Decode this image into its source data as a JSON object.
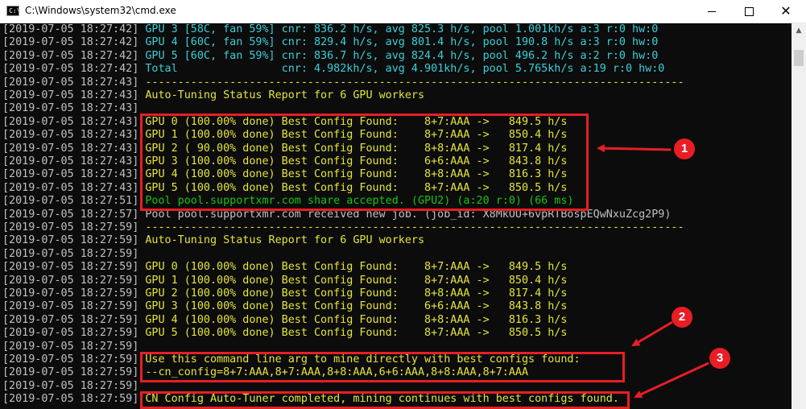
{
  "window": {
    "title": "C:\\Windows\\system32\\cmd.exe",
    "icon_label": "C:\\",
    "minimize_icon": "minimize-icon",
    "maximize_icon": "maximize-icon",
    "close_icon": "close-icon"
  },
  "colors": {
    "console_bg": "#0c0c0c",
    "timestamp": "#c0c0c0",
    "cyan": "#3ad0d9",
    "yellow": "#e5e53b",
    "green": "#16c60c",
    "annotation_red": "#e81e24"
  },
  "lines": [
    {
      "ts": "[2019-07-05 18:27:42]",
      "msg": " GPU 3 [58C, fan 59%] cnr: 836.2 h/s, avg 825.3 h/s, pool 1.001kh/s a:3 r:0 hw:0"
    },
    {
      "ts": "[2019-07-05 18:27:42]",
      "msg": " GPU 4 [60C, fan 59%] cnr: 829.4 h/s, avg 801.4 h/s, pool 190.8 h/s a:3 r:0 hw:0"
    },
    {
      "ts": "[2019-07-05 18:27:42]",
      "msg": " GPU 5 [60C, fan 59%] cnr: 836.7 h/s, avg 824.4 h/s, pool 496.2 h/s a:2 r:0 hw:0"
    },
    {
      "ts": "[2019-07-05 18:27:42]",
      "msg": " Total                cnr: 4.982kh/s, avg 4.901kh/s, pool 5.765kh/s a:19 r:0 hw:0"
    },
    {
      "ts": "[2019-07-05 18:27:43]",
      "msg": " -----------------------------------------------------------------------------------"
    },
    {
      "ts": "[2019-07-05 18:27:43]",
      "msg": " Auto-Tuning Status Report for 6 GPU workers"
    },
    {
      "ts": "[2019-07-05 18:27:43]",
      "msg": ""
    },
    {
      "ts": "[2019-07-05 18:27:43]",
      "msg": " GPU 0 (100.00% done) Best Config Found:    8+7:AAA ->   849.5 h/s"
    },
    {
      "ts": "[2019-07-05 18:27:43]",
      "msg": " GPU 1 (100.00% done) Best Config Found:    8+7:AAA ->   850.4 h/s"
    },
    {
      "ts": "[2019-07-05 18:27:43]",
      "msg": " GPU 2 ( 90.00% done) Best Config Found:    8+8:AAA ->   817.4 h/s"
    },
    {
      "ts": "[2019-07-05 18:27:43]",
      "msg": " GPU 3 (100.00% done) Best Config Found:    6+6:AAA ->   843.8 h/s"
    },
    {
      "ts": "[2019-07-05 18:27:43]",
      "msg": " GPU 4 (100.00% done) Best Config Found:    8+8:AAA ->   816.3 h/s"
    },
    {
      "ts": "[2019-07-05 18:27:43]",
      "msg": " GPU 5 (100.00% done) Best Config Found:    8+7:AAA ->   850.5 h/s"
    },
    {
      "ts": "[2019-07-05 18:27:51]",
      "msg": " Pool pool.supportxmr.com share accepted. (GPU2) (a:20 r:0) (66 ms)"
    },
    {
      "ts": "[2019-07-05 18:27:57]",
      "msg": " Pool pool.supportxmr.com received new job. (job_id: X8MkOU+6vpRTBospEQwNxuZcg2P9)"
    },
    {
      "ts": "[2019-07-05 18:27:59]",
      "msg": " -----------------------------------------------------------------------------------"
    },
    {
      "ts": "[2019-07-05 18:27:59]",
      "msg": " Auto-Tuning Status Report for 6 GPU workers"
    },
    {
      "ts": "[2019-07-05 18:27:59]",
      "msg": ""
    },
    {
      "ts": "[2019-07-05 18:27:59]",
      "msg": " GPU 0 (100.00% done) Best Config Found:    8+7:AAA ->   849.5 h/s"
    },
    {
      "ts": "[2019-07-05 18:27:59]",
      "msg": " GPU 1 (100.00% done) Best Config Found:    8+7:AAA ->   850.4 h/s"
    },
    {
      "ts": "[2019-07-05 18:27:59]",
      "msg": " GPU 2 (100.00% done) Best Config Found:    8+8:AAA ->   817.4 h/s"
    },
    {
      "ts": "[2019-07-05 18:27:59]",
      "msg": " GPU 3 (100.00% done) Best Config Found:    6+6:AAA ->   843.8 h/s"
    },
    {
      "ts": "[2019-07-05 18:27:59]",
      "msg": " GPU 4 (100.00% done) Best Config Found:    8+8:AAA ->   816.3 h/s"
    },
    {
      "ts": "[2019-07-05 18:27:59]",
      "msg": " GPU 5 (100.00% done) Best Config Found:    8+7:AAA ->   850.5 h/s"
    },
    {
      "ts": "[2019-07-05 18:27:59]",
      "msg": ""
    },
    {
      "ts": "[2019-07-05 18:27:59]",
      "msg": " Use this command line arg to mine directly with best configs found:"
    },
    {
      "ts": "[2019-07-05 18:27:59]",
      "msg": " --cn_config=8+7:AAA,8+7:AAA,8+8:AAA,6+6:AAA,8+8:AAA,8+7:AAA"
    },
    {
      "ts": "[2019-07-05 18:27:59]",
      "msg": ""
    },
    {
      "ts": "[2019-07-05 18:27:59]",
      "msg": " CN Config Auto-Tuner completed, mining continues with best configs found."
    }
  ],
  "annotations": {
    "badge_1": "1",
    "badge_2": "2",
    "badge_3": "3"
  },
  "scrollbar": {
    "up_icon": "scroll-up-arrow-icon"
  }
}
